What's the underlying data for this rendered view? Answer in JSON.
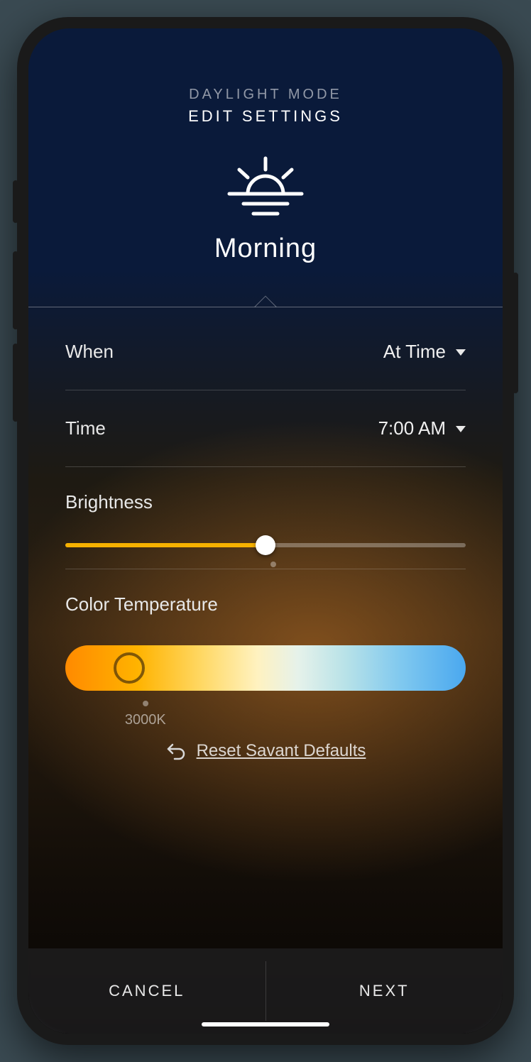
{
  "header": {
    "eyebrow": "DAYLIGHT MODE",
    "title": "EDIT SETTINGS",
    "mode_name": "Morning"
  },
  "rows": {
    "when": {
      "label": "When",
      "value": "At Time"
    },
    "time": {
      "label": "Time",
      "value": "7:00 AM"
    }
  },
  "brightness": {
    "label": "Brightness",
    "percent": 50,
    "default_marker_percent": 52
  },
  "color_temp": {
    "label": "Color Temperature",
    "thumb_percent": 16,
    "marker_percent": 20,
    "marker_label": "3000K"
  },
  "reset": {
    "label": "Reset Savant Defaults"
  },
  "footer": {
    "cancel": "CANCEL",
    "next": "NEXT"
  },
  "colors": {
    "accent": "#f6b100"
  }
}
